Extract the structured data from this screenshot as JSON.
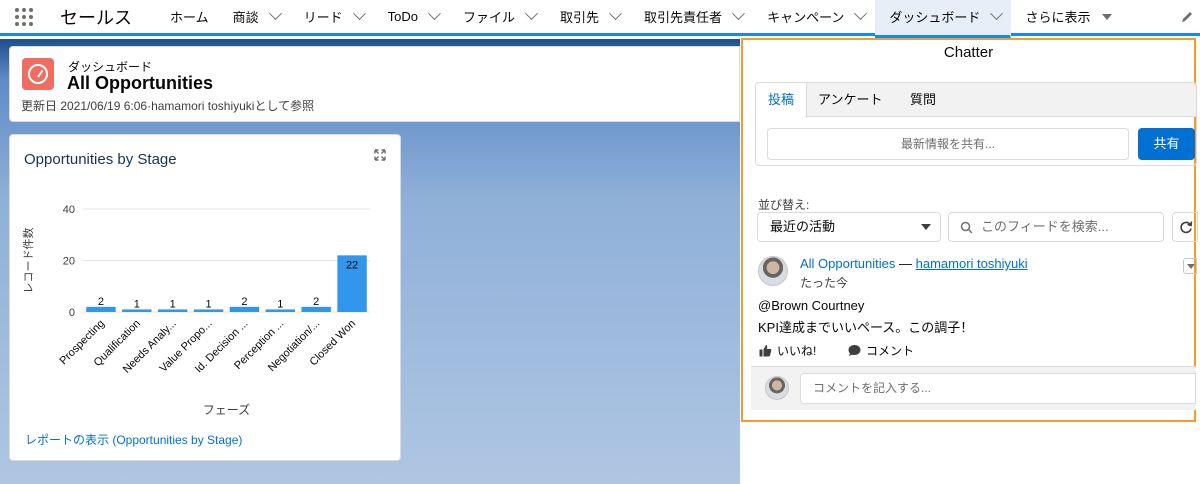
{
  "app": {
    "name": "セールス"
  },
  "nav": {
    "items": [
      {
        "label": "ホーム",
        "dropdown": false,
        "active": false
      },
      {
        "label": "商談",
        "dropdown": true,
        "active": false
      },
      {
        "label": "リード",
        "dropdown": true,
        "active": false
      },
      {
        "label": "ToDo",
        "dropdown": true,
        "active": false
      },
      {
        "label": "ファイル",
        "dropdown": true,
        "active": false
      },
      {
        "label": "取引先",
        "dropdown": true,
        "active": false
      },
      {
        "label": "取引先責任者",
        "dropdown": true,
        "active": false
      },
      {
        "label": "キャンペーン",
        "dropdown": true,
        "active": false
      },
      {
        "label": "ダッシュボード",
        "dropdown": true,
        "active": true
      }
    ],
    "more_label": "さらに表示"
  },
  "header": {
    "subtitle": "ダッシュボード",
    "title": "All Opportunities",
    "meta": "更新日 2021/06/19 6:06·hamamori toshiyukiとして参照"
  },
  "chart_card": {
    "title": "Opportunities by Stage",
    "report_link": "レポートの表示 (Opportunities by Stage)"
  },
  "chart_data": {
    "type": "bar",
    "categories": [
      "Prospecting",
      "Qualification",
      "Needs Analy...",
      "Value Propo...",
      "Id. Decision ...",
      "Perception ...",
      "Negotiation/...",
      "Closed Won"
    ],
    "values": [
      2,
      1,
      1,
      1,
      2,
      1,
      2,
      22
    ],
    "xlabel": "フェーズ",
    "ylabel": "レコード件数",
    "ylim": [
      0,
      40
    ],
    "yticks": [
      0,
      20,
      40
    ],
    "bar_color": "#3296ed",
    "grid": true
  },
  "chatter": {
    "title": "Chatter",
    "tabs": [
      "投稿",
      "アンケート",
      "質問"
    ],
    "share_placeholder": "最新情報を共有...",
    "share_button": "共有",
    "sort_label": "並び替え:",
    "sort_value": "最近の活動",
    "search_placeholder": "このフィードを検索...",
    "post": {
      "record": "All Opportunities",
      "separator": " — ",
      "author": "hamamori toshiyuki",
      "time": "たった今",
      "mention": "@Brown Courtney",
      "body": "KPI達成までいいペース。この調子！",
      "like_label": "いいね!",
      "comment_label": "コメント"
    },
    "comment_placeholder": "コメントを記入する..."
  },
  "colors": {
    "accent": "#1589ee",
    "brand_blue": "#0070d2",
    "highlight_border": "#f39c2b",
    "dashboard_icon": "#ef6e64"
  }
}
